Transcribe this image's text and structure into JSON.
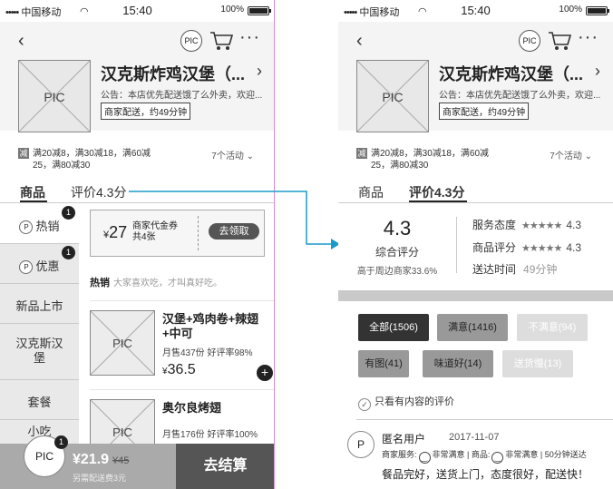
{
  "status": {
    "carrier": "中国移动",
    "time": "15:40",
    "battery": "100%",
    "battery_level": 1.0
  },
  "header": {
    "pic_label": "PIC",
    "shop_pic_label": "PIC",
    "shop_name": "汉克斯炸鸡汉堡（...",
    "notice": "公告：本店优先配送饿了么外卖，欢迎...",
    "delivery_tag": "商家配送，约49分钟"
  },
  "promo": {
    "badge": "减",
    "text": "满20减8，满30减18，满60减25，满80减30",
    "activities": "7个活动"
  },
  "tabs": {
    "goods": "商品",
    "rating": "评价4.3分"
  },
  "sidebar": {
    "items": [
      {
        "label": "热销",
        "badge": "1",
        "icon": "P"
      },
      {
        "label": "优惠",
        "badge": "1",
        "icon": "P"
      },
      {
        "label": "新品上市"
      },
      {
        "label": "汉克斯汉堡"
      },
      {
        "label": "套餐"
      },
      {
        "label": "小吃"
      }
    ]
  },
  "coupon": {
    "currency": "¥",
    "amount": "27",
    "title": "商家代金券",
    "count": "共4张",
    "button": "去领取"
  },
  "hot": {
    "title": "热销",
    "hint": "大家喜欢吃，才叫真好吃。"
  },
  "foods": [
    {
      "pic": "PIC",
      "name": "汉堡+鸡肉卷+辣翅+中可",
      "sales": "月售437份  好评率98%",
      "currency": "¥",
      "price": "36.5",
      "add": "+"
    },
    {
      "pic": "PIC",
      "name": "奥尔良烤翅",
      "sales": "月售176份  好评率100%"
    }
  ],
  "cart": {
    "label": "PIC",
    "badge": "1",
    "total": "¥21.9",
    "old": "¥45",
    "extra": "另需配送费3元",
    "checkout": "去结算"
  },
  "rating": {
    "score": "4.3",
    "score_label": "综合评分",
    "compare": "高于周边商家33.6%",
    "service_label": "服务态度",
    "service_stars": "★★★★★",
    "service_value": "4.3",
    "goods_label": "商品评分",
    "goods_stars": "★★★★★",
    "goods_value": "4.3",
    "delivery_label": "送达时间",
    "delivery_value": "49分钟"
  },
  "filters": {
    "all": "全部(1506)",
    "satisfied": "满意(1416)",
    "unsatisfied": "不满意(94)",
    "with_pic": "有图(41)",
    "tasty": "味道好(14)",
    "slow": "送货慢(13)"
  },
  "only_content": "只看有内容的评价",
  "review": {
    "avatar": "P",
    "user": "匿名用户",
    "date": "2017-11-07",
    "tag1_label": "商家服务:",
    "tag1_value": "非常满意",
    "tag2_label": "商品:",
    "tag2_value": "非常满意",
    "tag3": "50分钟送达",
    "comment": "餐品完好，送货上门，态度很好，配送快！"
  },
  "colors": {
    "arrow": "#1a9bc9",
    "divider": "#d98ad6"
  }
}
